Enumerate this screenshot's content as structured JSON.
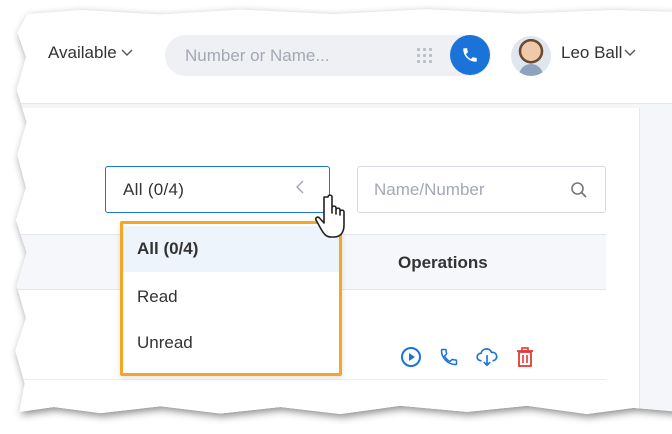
{
  "header": {
    "status_label": "Available",
    "search_placeholder": "Number or Name...",
    "user_name": "Leo Ball",
    "icons": [
      "chevron-down-icon",
      "dialpad-icon",
      "phone-icon",
      "avatar"
    ]
  },
  "filters": {
    "selected_value": "All  (0/4)",
    "options": [
      "All  (0/4)",
      "Read",
      "Unread"
    ],
    "name_search_placeholder": "Name/Number"
  },
  "table": {
    "operations_header": "Operations",
    "row_actions": [
      "play-icon",
      "phone-icon",
      "download-icon",
      "delete-icon"
    ]
  },
  "colors": {
    "accent": "#1a73d9",
    "highlight": "#f5a623",
    "delete": "#e53935"
  }
}
